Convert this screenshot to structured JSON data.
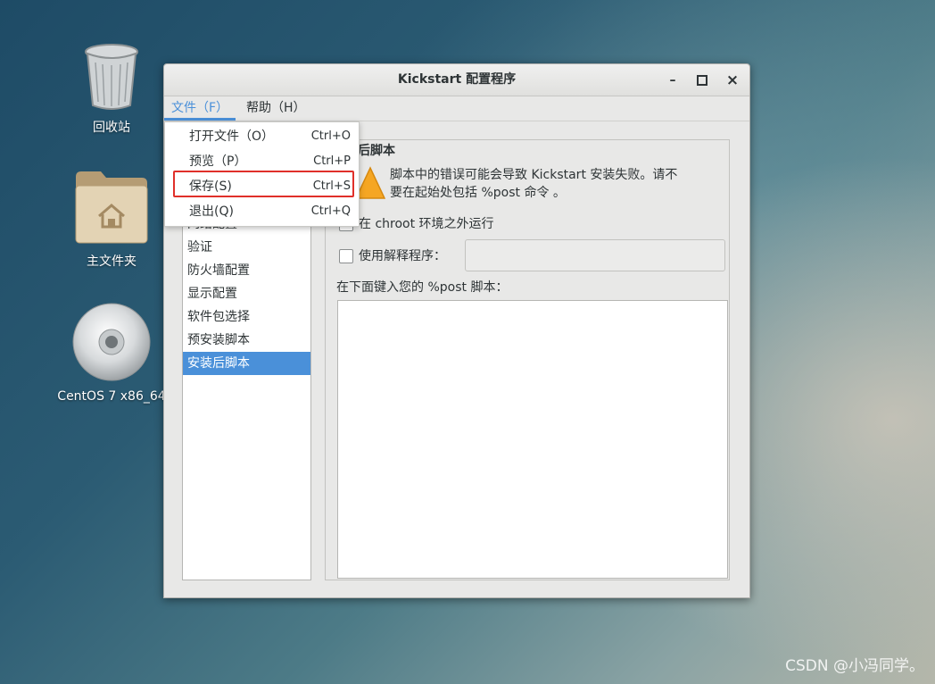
{
  "desktop": {
    "icons": [
      {
        "label": "回收站"
      },
      {
        "label": "主文件夹"
      },
      {
        "label": "CentOS 7 x86_64"
      }
    ]
  },
  "window": {
    "title": "Kickstart 配置程序",
    "controls": {
      "minimize": "–",
      "maximize": "□",
      "close": "×"
    }
  },
  "menubar": {
    "file": "文件（F）",
    "help": "帮助（H）"
  },
  "file_menu": [
    {
      "label": "打开文件（O）",
      "accel": "Ctrl+O"
    },
    {
      "label": "预览（P）",
      "accel": "Ctrl+P"
    },
    {
      "label": "保存(S)",
      "accel": "Ctrl+S"
    },
    {
      "label": "退出(Q)",
      "accel": "Ctrl+Q"
    }
  ],
  "sidebar": {
    "items": [
      {
        "label": "网络配置"
      },
      {
        "label": "验证"
      },
      {
        "label": "防火墙配置"
      },
      {
        "label": "显示配置"
      },
      {
        "label": "软件包选择"
      },
      {
        "label": "预安装脚本"
      },
      {
        "label": "安装后脚本"
      }
    ],
    "selected": "安装后脚本"
  },
  "panel": {
    "title": "后脚本",
    "warning_line1": "脚本中的错误可能会导致  Kickstart 安装失败。请不",
    "warning_line2": "要在起始处包括 %post 命令 。",
    "chroot_label": "在  chroot 环境之外运行",
    "interpreter_label": "使用解释程序：",
    "script_prompt": "在下面键入您的  %post 脚本：",
    "chroot_checked": false,
    "interpreter_checked": false
  },
  "watermark": "CSDN @小冯同学。",
  "colors": {
    "accent": "#4a90d9",
    "highlight_box": "#e0302a",
    "warning": "#f5a623"
  }
}
